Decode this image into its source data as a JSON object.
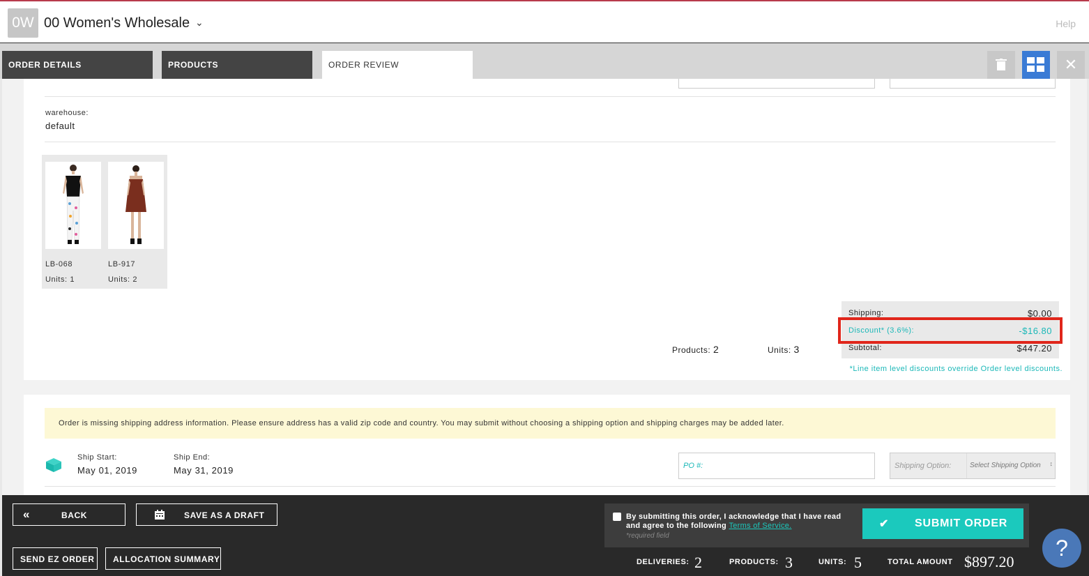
{
  "header": {
    "avatar_initials": "0W",
    "store_name": "00 Women's Wholesale",
    "help_label": "Help"
  },
  "tabs": [
    {
      "label": "ORDER DETAILS"
    },
    {
      "label": "PRODUCTS"
    },
    {
      "label": "ORDER REVIEW"
    }
  ],
  "toolbar": {
    "trash_icon": "trash-icon",
    "grid_icon": "grid-view-icon",
    "close_icon": "close-icon"
  },
  "warehouse": {
    "label": "warehouse:",
    "value": "default"
  },
  "products": [
    {
      "sku": "LB-068",
      "units": "Units: 1"
    },
    {
      "sku": "LB-917",
      "units": "Units: 2"
    }
  ],
  "summary": {
    "products_label": "Products:",
    "products_value": "2",
    "units_label": "Units:",
    "units_value": "3",
    "shipping_label": "Shipping:",
    "shipping_value": "$0.00",
    "discount_label": "Discount* (3.6%):",
    "discount_value": "-$16.80",
    "subtotal_label": "Subtotal:",
    "subtotal_value": "$447.20",
    "discount_note": "*Line item level discounts override Order level discounts."
  },
  "shipping": {
    "notice": "Order is missing shipping address information. Please ensure address has a valid zip code and country. You may submit without choosing a shipping option and shipping charges may be added later.",
    "ship_start_label": "Ship Start:",
    "ship_start_value": "May 01, 2019",
    "ship_end_label": "Ship End:",
    "ship_end_value": "May 31, 2019",
    "po_placeholder": "PO #:",
    "shipping_option_label": "Shipping Option:",
    "shipping_option_value": "Select Shipping Option"
  },
  "footer": {
    "back_label": "BACK",
    "save_draft_label": "SAVE AS A DRAFT",
    "send_ez_label": "SEND EZ ORDER",
    "allocation_label": "ALLOCATION SUMMARY",
    "terms_text": "By submitting this order, I acknowledge that I have read and agree to the following",
    "terms_link": "Terms of Service.",
    "required_note": "*required field",
    "submit_label": "SUBMIT ORDER",
    "deliveries_label": "DELIVERIES:",
    "deliveries_value": "2",
    "products_label": "PRODUCTS:",
    "products_value": "3",
    "units_label": "UNITS:",
    "units_value": "5",
    "total_label": "TOTAL AMOUNT",
    "total_value": "$897.20"
  },
  "colors": {
    "accent_teal": "#1bc9bd",
    "highlight_red": "#e0261b",
    "tab_dark": "#444444",
    "active_blue": "#3a7bd5"
  }
}
